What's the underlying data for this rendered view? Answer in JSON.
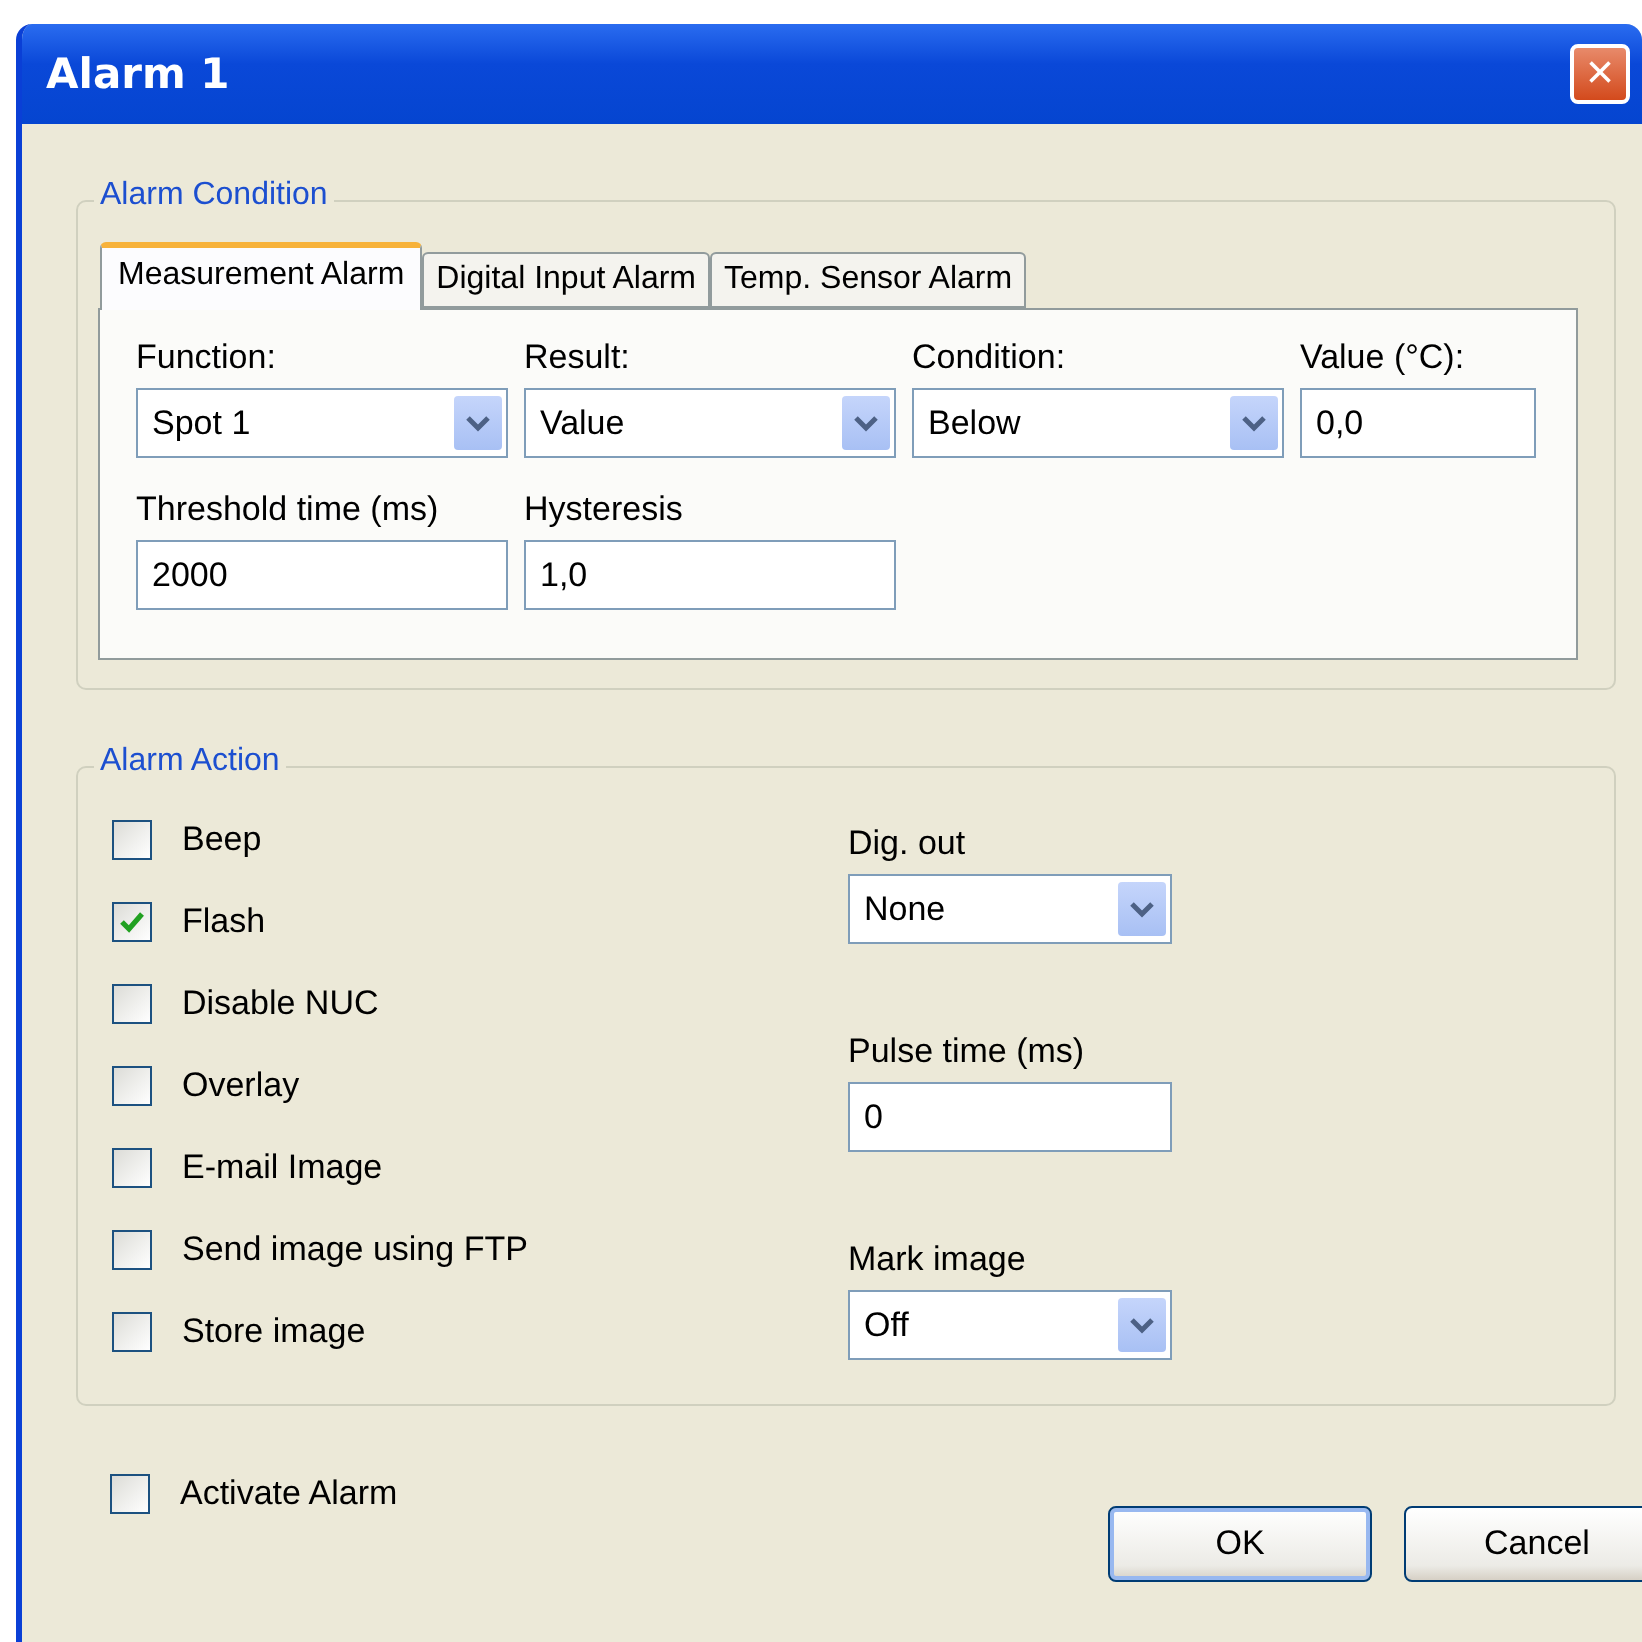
{
  "window": {
    "title": "Alarm 1",
    "close": "×"
  },
  "alarm_condition": {
    "title": "Alarm Condition",
    "tabs": [
      {
        "label": "Measurement Alarm",
        "selected": true
      },
      {
        "label": "Digital Input Alarm",
        "selected": false
      },
      {
        "label": "Temp. Sensor Alarm",
        "selected": false
      }
    ],
    "fields": [
      {
        "kind": "combo",
        "label": "Function:",
        "value": "Spot 1"
      },
      {
        "kind": "combo",
        "label": "Result:",
        "value": "Value"
      },
      {
        "kind": "combo",
        "label": "Condition:",
        "value": "Below"
      },
      {
        "kind": "text",
        "label": "Value (°C):",
        "value": "0,0"
      },
      {
        "kind": "text",
        "label": "Threshold time (ms)",
        "value": "2000"
      },
      {
        "kind": "text",
        "label": "Hysteresis",
        "value": "1,0"
      }
    ]
  },
  "alarm_action": {
    "title": "Alarm Action",
    "checkboxes": [
      {
        "label": "Beep",
        "checked": false
      },
      {
        "label": "Flash",
        "checked": true
      },
      {
        "label": "Disable NUC",
        "checked": false
      },
      {
        "label": "Overlay",
        "checked": false
      },
      {
        "label": "E-mail Image",
        "checked": false
      },
      {
        "label": "Send image using FTP",
        "checked": false
      },
      {
        "label": "Store image",
        "checked": false
      }
    ],
    "fields": [
      {
        "kind": "combo",
        "label": "Dig. out",
        "value": "None"
      },
      {
        "kind": "text",
        "label": "Pulse time (ms)",
        "value": "0"
      },
      {
        "kind": "combo",
        "label": "Mark image",
        "value": "Off"
      }
    ]
  },
  "activate": {
    "label": "Activate Alarm",
    "checked": false
  },
  "buttons": [
    "OK",
    "Cancel"
  ]
}
